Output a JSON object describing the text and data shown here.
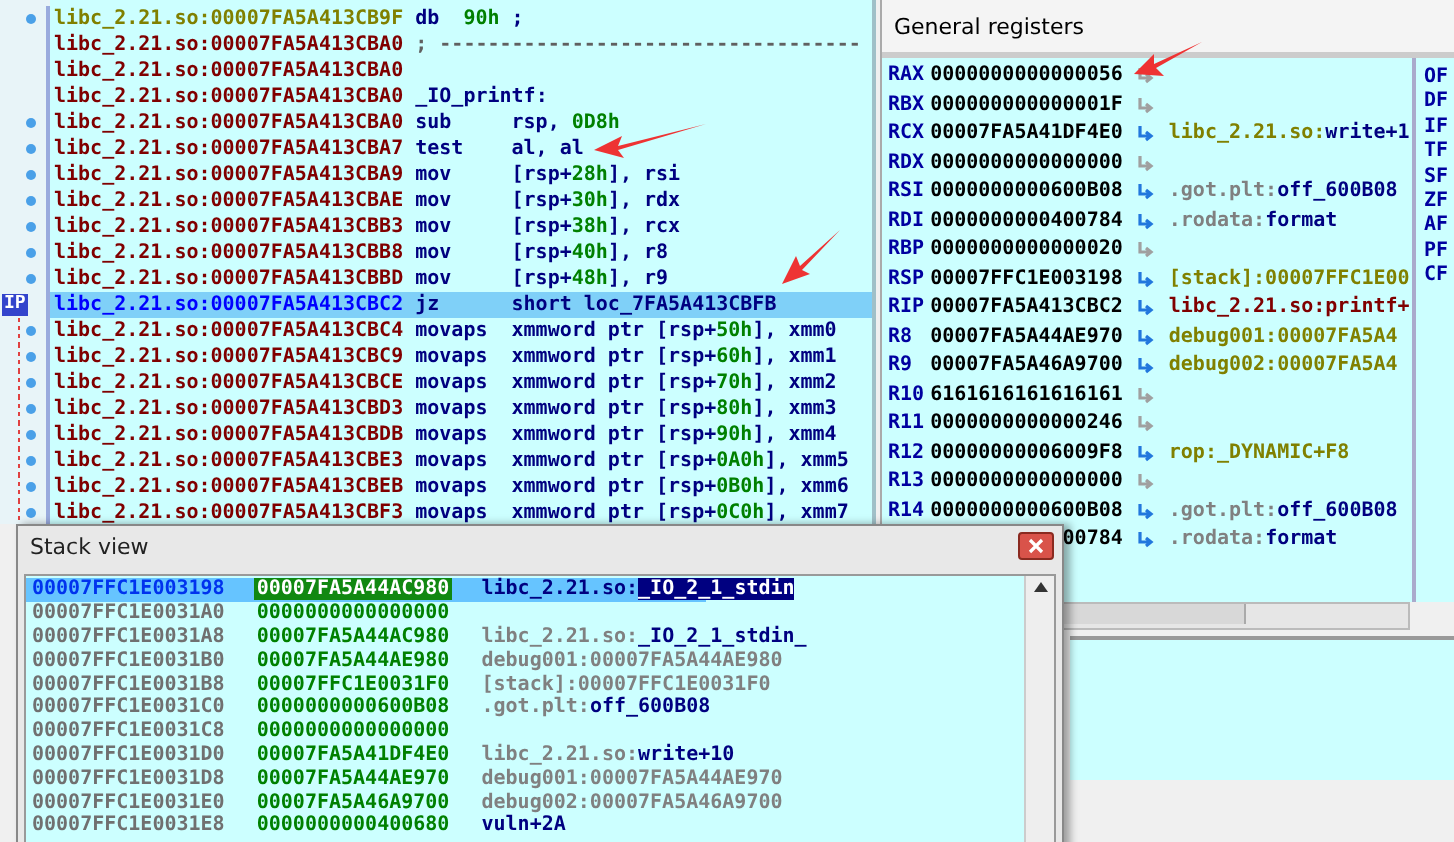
{
  "disassembly": {
    "ip_label": "IP",
    "lines": [
      {
        "kind": "data",
        "address": "libc_2.21.so:00007FA5A413CB9F",
        "mnemonic": "db",
        "operands": [
          {
            "text": "90h",
            "kind": "num"
          },
          {
            "text": " ;",
            "kind": "plain"
          }
        ],
        "dot": true,
        "selected": false
      },
      {
        "kind": "separator",
        "address": "libc_2.21.so:00007FA5A413CBA0",
        "comment": "; -----------------------------------",
        "dot": false,
        "selected": false
      },
      {
        "kind": "code",
        "address": "libc_2.21.so:00007FA5A413CBA0",
        "dot": false,
        "selected": false
      },
      {
        "kind": "label",
        "address": "libc_2.21.so:00007FA5A413CBA0",
        "label": "_IO_printf:",
        "dot": false,
        "selected": false
      },
      {
        "kind": "code",
        "address": "libc_2.21.so:00007FA5A413CBA0",
        "mnemonic": "sub",
        "operands": [
          {
            "text": "rsp, ",
            "kind": "plain"
          },
          {
            "text": "0D8h",
            "kind": "num"
          }
        ],
        "dot": true,
        "selected": false
      },
      {
        "kind": "code",
        "address": "libc_2.21.so:00007FA5A413CBA7",
        "mnemonic": "test",
        "operands": [
          {
            "text": "al, al",
            "kind": "plain"
          }
        ],
        "dot": true,
        "selected": false
      },
      {
        "kind": "code",
        "address": "libc_2.21.so:00007FA5A413CBA9",
        "mnemonic": "mov",
        "operands": [
          {
            "text": "[rsp+",
            "kind": "plain"
          },
          {
            "text": "28h",
            "kind": "num"
          },
          {
            "text": "], rsi",
            "kind": "plain"
          }
        ],
        "dot": true,
        "selected": false
      },
      {
        "kind": "code",
        "address": "libc_2.21.so:00007FA5A413CBAE",
        "mnemonic": "mov",
        "operands": [
          {
            "text": "[rsp+",
            "kind": "plain"
          },
          {
            "text": "30h",
            "kind": "num"
          },
          {
            "text": "], rdx",
            "kind": "plain"
          }
        ],
        "dot": true,
        "selected": false
      },
      {
        "kind": "code",
        "address": "libc_2.21.so:00007FA5A413CBB3",
        "mnemonic": "mov",
        "operands": [
          {
            "text": "[rsp+",
            "kind": "plain"
          },
          {
            "text": "38h",
            "kind": "num"
          },
          {
            "text": "], rcx",
            "kind": "plain"
          }
        ],
        "dot": true,
        "selected": false
      },
      {
        "kind": "code",
        "address": "libc_2.21.so:00007FA5A413CBB8",
        "mnemonic": "mov",
        "operands": [
          {
            "text": "[rsp+",
            "kind": "plain"
          },
          {
            "text": "40h",
            "kind": "num"
          },
          {
            "text": "], r8",
            "kind": "plain"
          }
        ],
        "dot": true,
        "selected": false
      },
      {
        "kind": "code",
        "address": "libc_2.21.so:00007FA5A413CBBD",
        "mnemonic": "mov",
        "operands": [
          {
            "text": "[rsp+",
            "kind": "plain"
          },
          {
            "text": "48h",
            "kind": "num"
          },
          {
            "text": "], r9",
            "kind": "plain"
          }
        ],
        "dot": true,
        "selected": false
      },
      {
        "kind": "code",
        "address": "libc_2.21.so:00007FA5A413CBC2",
        "mnemonic": "jz",
        "operands": [
          {
            "text": "short loc_7FA5A413CBFB",
            "kind": "plain"
          }
        ],
        "dot": false,
        "selected": true
      },
      {
        "kind": "code",
        "address": "libc_2.21.so:00007FA5A413CBC4",
        "mnemonic": "movaps",
        "operands": [
          {
            "text": "xmmword ptr [rsp+",
            "kind": "plain"
          },
          {
            "text": "50h",
            "kind": "num"
          },
          {
            "text": "], xmm0",
            "kind": "plain"
          }
        ],
        "dot": true,
        "selected": false
      },
      {
        "kind": "code",
        "address": "libc_2.21.so:00007FA5A413CBC9",
        "mnemonic": "movaps",
        "operands": [
          {
            "text": "xmmword ptr [rsp+",
            "kind": "plain"
          },
          {
            "text": "60h",
            "kind": "num"
          },
          {
            "text": "], xmm1",
            "kind": "plain"
          }
        ],
        "dot": true,
        "selected": false
      },
      {
        "kind": "code",
        "address": "libc_2.21.so:00007FA5A413CBCE",
        "mnemonic": "movaps",
        "operands": [
          {
            "text": "xmmword ptr [rsp+",
            "kind": "plain"
          },
          {
            "text": "70h",
            "kind": "num"
          },
          {
            "text": "], xmm2",
            "kind": "plain"
          }
        ],
        "dot": true,
        "selected": false
      },
      {
        "kind": "code",
        "address": "libc_2.21.so:00007FA5A413CBD3",
        "mnemonic": "movaps",
        "operands": [
          {
            "text": "xmmword ptr [rsp+",
            "kind": "plain"
          },
          {
            "text": "80h",
            "kind": "num"
          },
          {
            "text": "], xmm3",
            "kind": "plain"
          }
        ],
        "dot": true,
        "selected": false
      },
      {
        "kind": "code",
        "address": "libc_2.21.so:00007FA5A413CBDB",
        "mnemonic": "movaps",
        "operands": [
          {
            "text": "xmmword ptr [rsp+",
            "kind": "plain"
          },
          {
            "text": "90h",
            "kind": "num"
          },
          {
            "text": "], xmm4",
            "kind": "plain"
          }
        ],
        "dot": true,
        "selected": false
      },
      {
        "kind": "code",
        "address": "libc_2.21.so:00007FA5A413CBE3",
        "mnemonic": "movaps",
        "operands": [
          {
            "text": "xmmword ptr [rsp+",
            "kind": "plain"
          },
          {
            "text": "0A0h",
            "kind": "num"
          },
          {
            "text": "], xmm5",
            "kind": "plain"
          }
        ],
        "dot": true,
        "selected": false
      },
      {
        "kind": "code",
        "address": "libc_2.21.so:00007FA5A413CBEB",
        "mnemonic": "movaps",
        "operands": [
          {
            "text": "xmmword ptr [rsp+",
            "kind": "plain"
          },
          {
            "text": "0B0h",
            "kind": "num"
          },
          {
            "text": "], xmm6",
            "kind": "plain"
          }
        ],
        "dot": true,
        "selected": false
      },
      {
        "kind": "code",
        "address": "libc_2.21.so:00007FA5A413CBF3",
        "mnemonic": "movaps",
        "operands": [
          {
            "text": "xmmword ptr [rsp+",
            "kind": "plain"
          },
          {
            "text": "0C0h",
            "kind": "num"
          },
          {
            "text": "], xmm7",
            "kind": "plain"
          }
        ],
        "dot": true,
        "selected": false
      }
    ]
  },
  "registers": {
    "title": "General registers",
    "rows": [
      {
        "name": "RAX",
        "value": "0000000000000056",
        "linked": false
      },
      {
        "name": "RBX",
        "value": "000000000000001F",
        "linked": false
      },
      {
        "name": "RCX",
        "value": "00007FA5A41DF4E0",
        "linked": true,
        "ref": [
          {
            "text": "libc_2.21.so:",
            "kind": "data"
          },
          {
            "text": "write+1",
            "kind": "symbol"
          }
        ]
      },
      {
        "name": "RDX",
        "value": "0000000000000000",
        "linked": false
      },
      {
        "name": "RSI",
        "value": "0000000000600B08",
        "linked": true,
        "ref": [
          {
            "text": ".got.plt:",
            "kind": "section"
          },
          {
            "text": "off_600B08",
            "kind": "symbol"
          }
        ]
      },
      {
        "name": "RDI",
        "value": "0000000000400784",
        "linked": true,
        "ref": [
          {
            "text": ".rodata:",
            "kind": "section"
          },
          {
            "text": "format",
            "kind": "symbol"
          }
        ]
      },
      {
        "name": "RBP",
        "value": "0000000000000020",
        "linked": false
      },
      {
        "name": "RSP",
        "value": "00007FFC1E003198",
        "linked": true,
        "ref": [
          {
            "text": "[stack]:00007FFC1E00",
            "kind": "data"
          }
        ]
      },
      {
        "name": "RIP",
        "value": "00007FA5A413CBC2",
        "linked": true,
        "ref": [
          {
            "text": "libc_2.21.so:printf+",
            "kind": "code"
          }
        ]
      },
      {
        "name": "R8",
        "value": "00007FA5A44AE970",
        "linked": true,
        "ref": [
          {
            "text": "debug001:00007FA5A4",
            "kind": "data"
          }
        ]
      },
      {
        "name": "R9",
        "value": "00007FA5A46A9700",
        "linked": true,
        "ref": [
          {
            "text": "debug002:00007FA5A4",
            "kind": "data"
          }
        ]
      },
      {
        "name": "R10",
        "value": "6161616161616161",
        "linked": false
      },
      {
        "name": "R11",
        "value": "0000000000000246",
        "linked": false
      },
      {
        "name": "R12",
        "value": "00000000006009F8",
        "linked": true,
        "ref": [
          {
            "text": "rop:_DYNAMIC+F8",
            "kind": "data"
          }
        ]
      },
      {
        "name": "R13",
        "value": "0000000000000000",
        "linked": false
      },
      {
        "name": "R14",
        "value": "0000000000600B08",
        "linked": true,
        "ref": [
          {
            "text": ".got.plt:",
            "kind": "section"
          },
          {
            "text": "off_600B08",
            "kind": "symbol"
          }
        ]
      },
      {
        "value": "00784",
        "linked": true,
        "ref": [
          {
            "text": ".rodata:",
            "kind": "section"
          },
          {
            "text": "format",
            "kind": "symbol"
          }
        ]
      }
    ],
    "flags": [
      "OF",
      "DF",
      "IF",
      "TF",
      "SF",
      "ZF",
      "AF",
      "PF",
      "CF"
    ]
  },
  "stack_view": {
    "title": "Stack view",
    "rows": [
      {
        "address": "00007FFC1E003198",
        "value": "00007FA5A44AC980",
        "ref": [
          {
            "text": "libc_2.21.so:",
            "kind": "symbol"
          },
          {
            "text": "_IO_2_1_stdin",
            "kind": "mark"
          }
        ],
        "selected": true
      },
      {
        "address": "00007FFC1E0031A0",
        "value": "0000000000000000",
        "ref": [],
        "selected": false
      },
      {
        "address": "00007FFC1E0031A8",
        "value": "00007FA5A44AC980",
        "ref": [
          {
            "text": "libc_2.21.so:",
            "kind": "section"
          },
          {
            "text": "_IO_2_1_stdin_",
            "kind": "symbol"
          }
        ],
        "selected": false
      },
      {
        "address": "00007FFC1E0031B0",
        "value": "00007FA5A44AE980",
        "ref": [
          {
            "text": "debug001:00007FA5A44AE980",
            "kind": "section"
          }
        ],
        "selected": false
      },
      {
        "address": "00007FFC1E0031B8",
        "value": "00007FFC1E0031F0",
        "ref": [
          {
            "text": "[stack]:00007FFC1E0031F0",
            "kind": "section"
          }
        ],
        "selected": false
      },
      {
        "address": "00007FFC1E0031C0",
        "value": "0000000000600B08",
        "ref": [
          {
            "text": ".got.plt:",
            "kind": "section"
          },
          {
            "text": "off_600B08",
            "kind": "symbol"
          }
        ],
        "selected": false
      },
      {
        "address": "00007FFC1E0031C8",
        "value": "0000000000000000",
        "ref": [],
        "selected": false
      },
      {
        "address": "00007FFC1E0031D0",
        "value": "00007FA5A41DF4E0",
        "ref": [
          {
            "text": "libc_2.21.so:",
            "kind": "section"
          },
          {
            "text": "write+10",
            "kind": "symbol"
          }
        ],
        "selected": false
      },
      {
        "address": "00007FFC1E0031D8",
        "value": "00007FA5A44AE970",
        "ref": [
          {
            "text": "debug001:00007FA5A44AE970",
            "kind": "section"
          }
        ],
        "selected": false
      },
      {
        "address": "00007FFC1E0031E0",
        "value": "00007FA5A46A9700",
        "ref": [
          {
            "text": "debug002:00007FA5A46A9700",
            "kind": "section"
          }
        ],
        "selected": false
      },
      {
        "address": "00007FFC1E0031E8",
        "value": "0000000000400680",
        "ref": [
          {
            "text": "vuln+2A",
            "kind": "symbol"
          }
        ],
        "selected": false
      }
    ]
  }
}
